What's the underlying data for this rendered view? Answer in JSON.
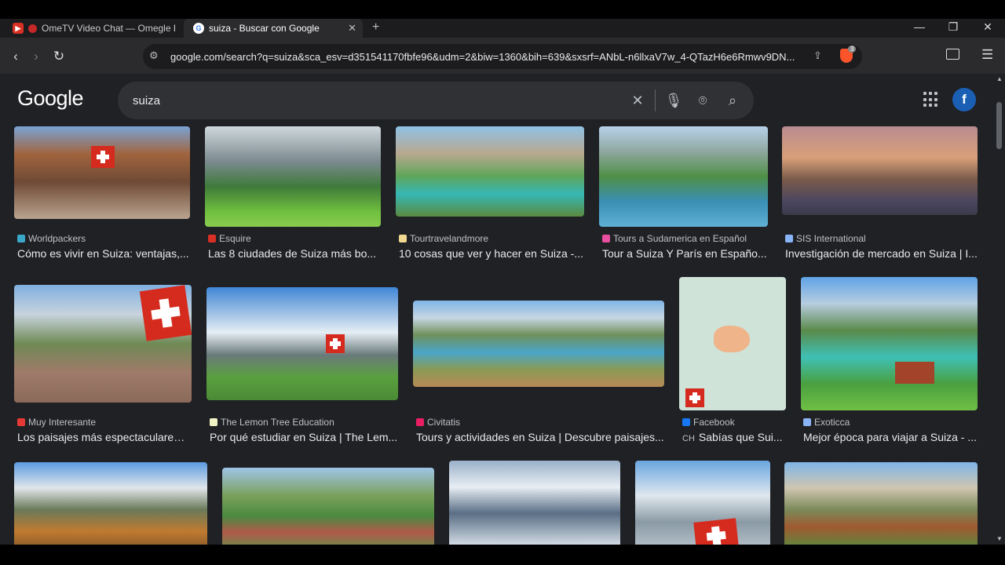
{
  "browser": {
    "tabs": [
      {
        "title": "OmeTV Video Chat — Omegle R",
        "active": false
      },
      {
        "title": "suiza - Buscar con Google",
        "active": true
      }
    ],
    "url": "google.com/search?q=suiza&sca_esv=d351541170fbfe96&udm=2&biw=1360&bih=639&sxsrf=ANbL-n6llxaV7w_4-QTazH6e6Rmwv9DN...",
    "brave_badge": "3"
  },
  "google": {
    "logo": "Google",
    "query": "suiza",
    "avatar_letter": "f"
  },
  "results": [
    {
      "source": "Worldpackers",
      "title": "Cómo es vivir en Suiza: ventajas,...",
      "fav": "#3aa7c8"
    },
    {
      "source": "Esquire",
      "title": "Las 8 ciudades de Suiza más bo...",
      "fav": "#d93025"
    },
    {
      "source": "Tourtravelandmore",
      "title": "10 cosas que ver y hacer en Suiza -...",
      "fav": "#f0d890"
    },
    {
      "source": "Tours a Sudamerica en Español",
      "title": "Tour a Suiza Y París en Españo...",
      "fav": "#e84fa0"
    },
    {
      "source": "SIS International",
      "title": "Investigación de mercado en Suiza | I...",
      "fav": "#8ab4f8"
    },
    {
      "source": "Muy Interesante",
      "title": "Los paisajes más espectaculares ...",
      "fav": "#e53935"
    },
    {
      "source": "The Lemon Tree Education",
      "title": "Por qué estudiar en Suiza | The Lem...",
      "fav": "#f1f3c4"
    },
    {
      "source": "Civitatis",
      "title": "Tours y actividades en Suiza | Descubre paisajes...",
      "fav": "#e91e63"
    },
    {
      "source": "Facebook",
      "title": "Sabías que Sui...",
      "title_prefix": "CH",
      "fav": "#1877f2"
    },
    {
      "source": "Exoticca",
      "title": "Mejor época para viajar a Suiza - ...",
      "fav": "#8ab4f8"
    }
  ]
}
